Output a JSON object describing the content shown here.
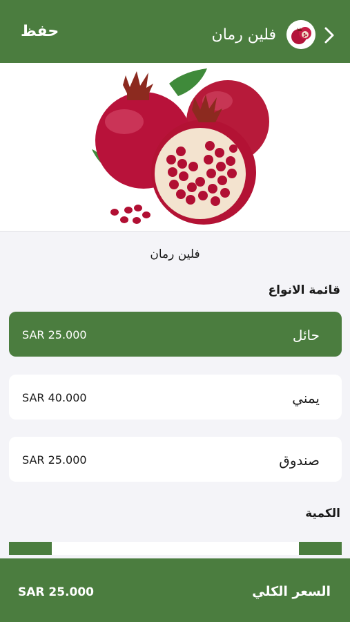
{
  "header": {
    "save_label": "حفظ",
    "title": "فلين رمان"
  },
  "product": {
    "name": "فلين رمان"
  },
  "types_section": {
    "title": "قائمة الانواع",
    "options": [
      {
        "name": "حائل",
        "price": "SAR 25.000",
        "selected": true
      },
      {
        "name": "يمني",
        "price": "SAR 40.000",
        "selected": false
      },
      {
        "name": "صندوق",
        "price": "SAR 25.000",
        "selected": false
      }
    ]
  },
  "quantity_section": {
    "title": "الكمية"
  },
  "footer": {
    "total_label": "السعر الكلي",
    "total_price": "SAR 25.000"
  },
  "colors": {
    "primary": "#4b7d3f",
    "background": "#f4f4f8",
    "card": "#ffffff"
  },
  "icons": {
    "back": "chevron-right-icon",
    "product": "pomegranate-icon"
  }
}
